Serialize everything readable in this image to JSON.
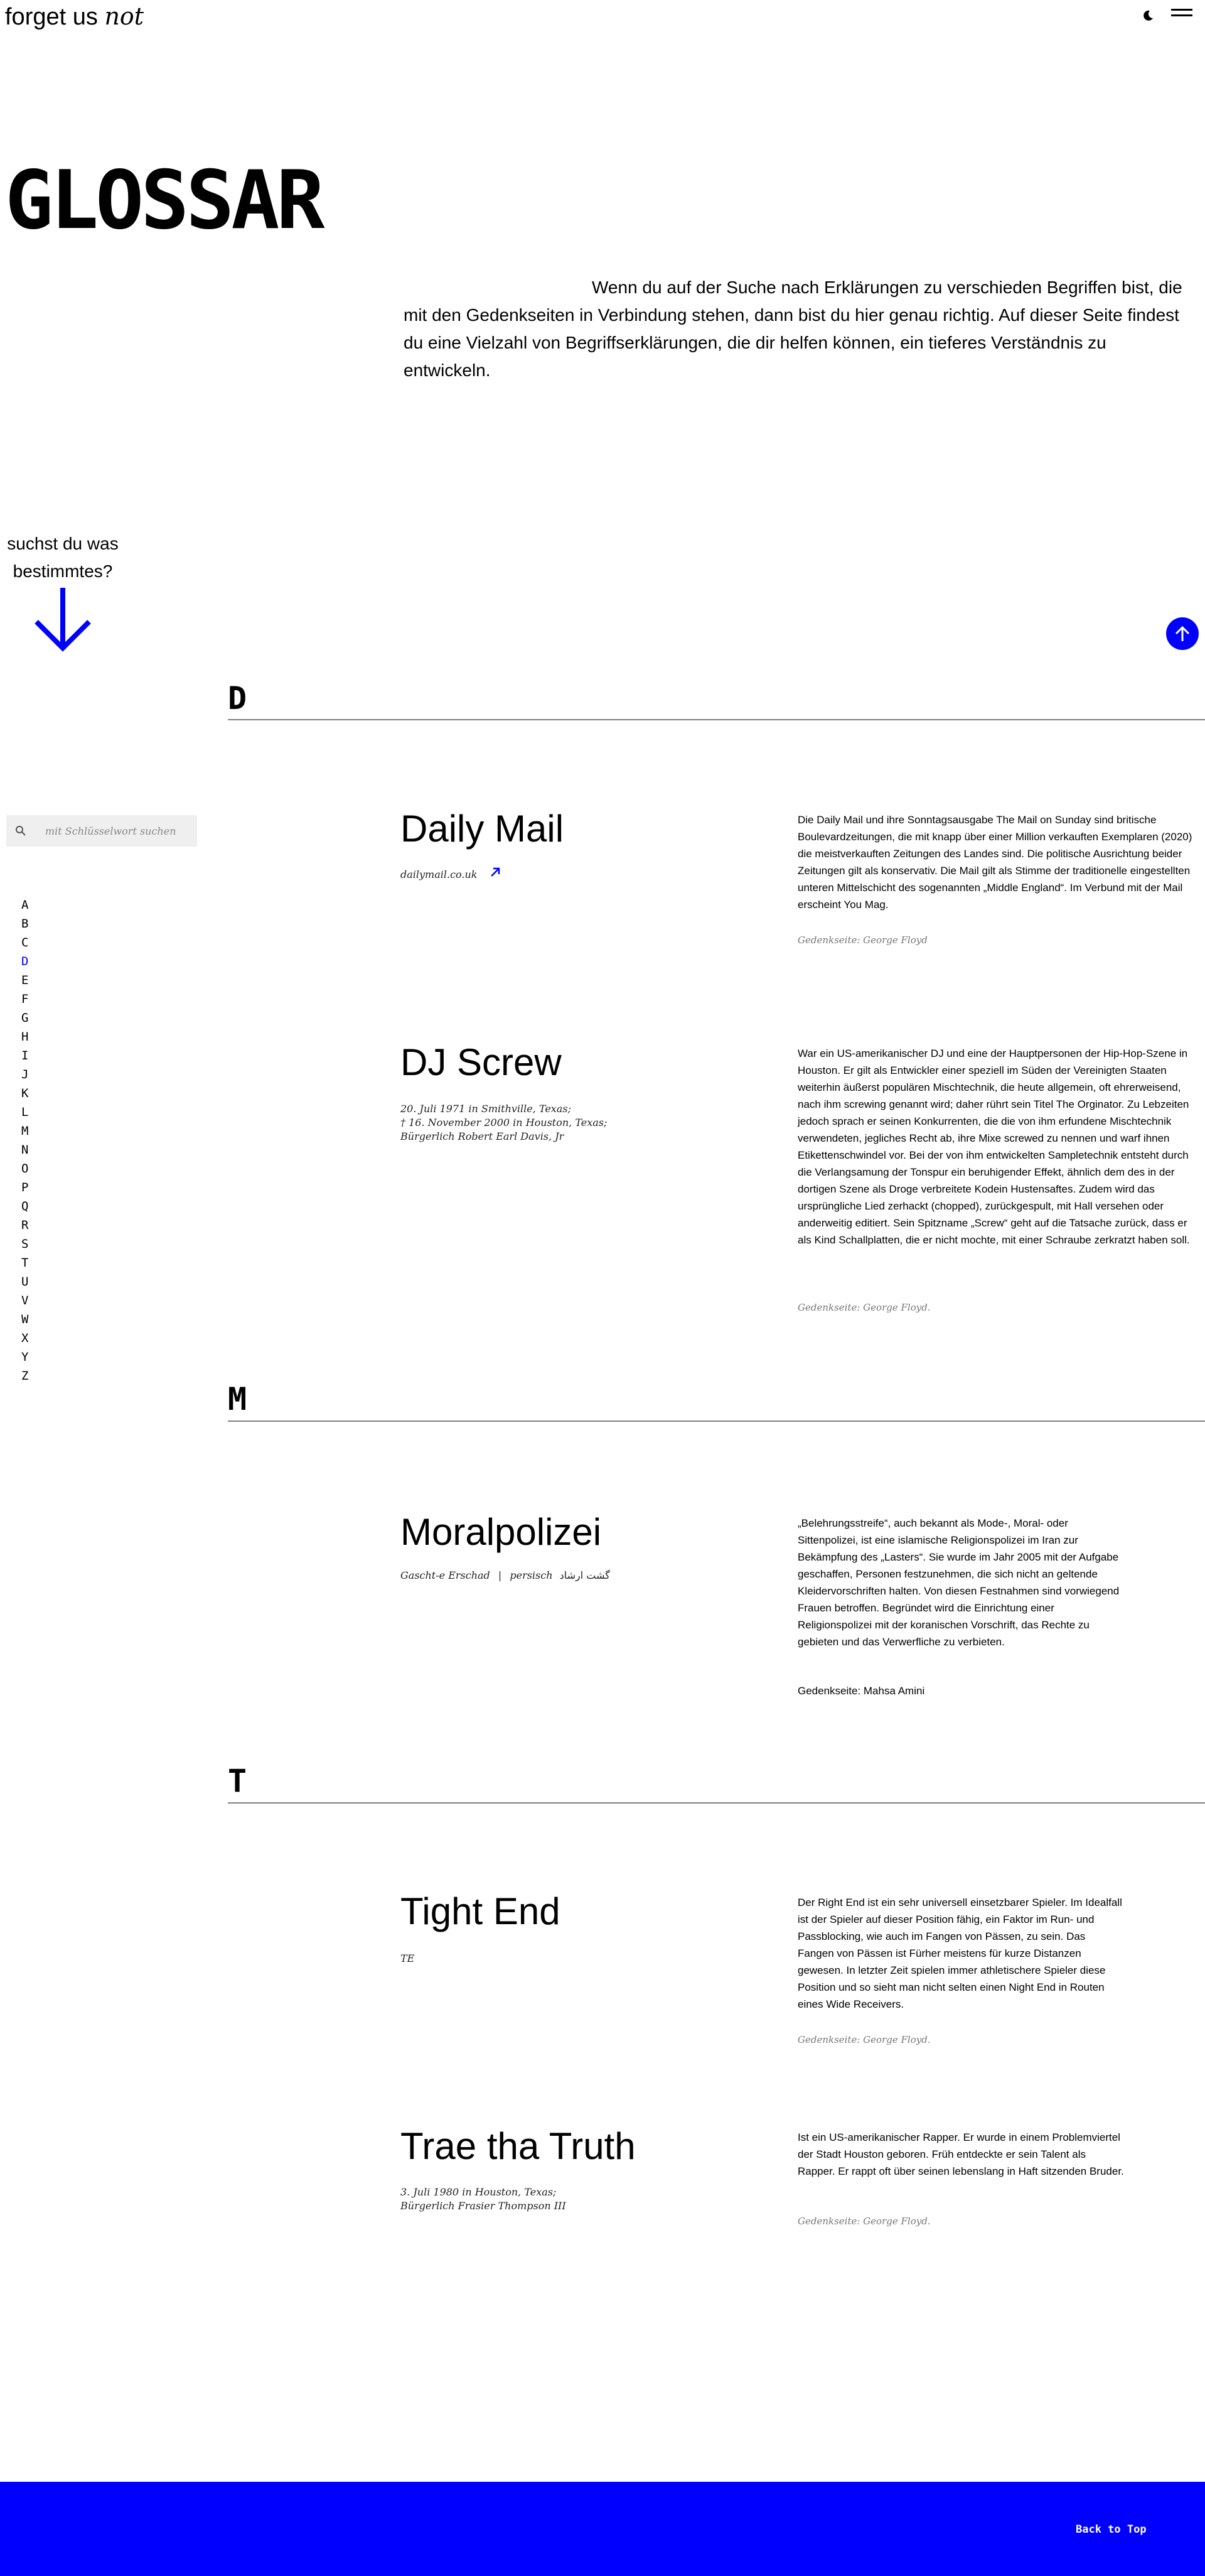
{
  "header": {
    "logo_main": "forget us",
    "logo_italic": "not"
  },
  "hero": {
    "title": "GLOSSAR",
    "intro": "Wenn du auf der Suche nach Erklärungen zu verschieden Begriffen bist, die mit den Gedenkseiten in Verbindung stehen, dann bist du hier genau richtig. Auf dieser Seite findest du eine Vielzahl von Begriffserklärungen, die dir helfen können, ein tieferes Verständnis zu entwickeln."
  },
  "sidebar": {
    "prompt_line1": "suchst du was",
    "prompt_line2": "bestimmtes?",
    "search_placeholder": "mit Schlüsselwort suchen",
    "letters": [
      "A",
      "B",
      "C",
      "D",
      "E",
      "F",
      "G",
      "H",
      "I",
      "J",
      "K",
      "L",
      "M",
      "N",
      "O",
      "P",
      "Q",
      "R",
      "S",
      "T",
      "U",
      "V",
      "W",
      "X",
      "Y",
      "Z"
    ],
    "active_letter": "D"
  },
  "sections": {
    "d": "D",
    "m": "M",
    "t": "T"
  },
  "entries": {
    "daily_mail": {
      "title": "Daily Mail",
      "link": "dailymail.co.uk",
      "desc": "Die Daily Mail und ihre Sonntagsausgabe The Mail on Sunday sind britische Boulevardzeitungen, die mit knapp über einer Million verkauften Exemplaren (2020) die meistverkauften Zeitungen des Landes sind. Die politische Ausrichtung beider Zeitungen gilt als konservativ. Die Mail gilt als Stimme der traditionelle eingestellten unteren Mittelschicht des sogenannten „Middle England“. Im Verbund mit der Mail erscheint You Mag.",
      "ref": "Gedenkseite: George Floyd"
    },
    "dj_screw": {
      "title": "DJ Screw",
      "meta1": "20. Juli 1971 in Smithville, Texas;",
      "meta2": "† 16. November 2000 in Houston, Texas;",
      "meta3": "Bürgerlich Robert Earl Davis, Jr",
      "desc": "War ein US-amerikanischer DJ und eine der Hauptpersonen der Hip-Hop-Szene in Houston. Er gilt als Entwickler einer speziell im Süden der Vereinigten Staaten weiterhin äußerst populären Mischtechnik, die heute allgemein, oft ehrerweisend, nach ihm screwing genannt wird; daher rührt sein Titel The Orginator. Zu Lebzeiten jedoch sprach er seinen Konkurrenten, die die von ihm erfundene Mischtechnik verwendeten, jegliches Recht ab, ihre Mixe screwed zu nennen und warf ihnen Etikettenschwindel vor. Bei der von ihm entwickelten Sampletechnik entsteht durch die Verlangsamung der Tonspur ein beruhigender Effekt, ähnlich dem des in der dortigen Szene als Droge verbreitete Kodein Hustensaftes. Zudem wird das ursprüngliche Lied zerhackt (chopped), zurückgespult, mit Hall versehen oder anderweitig editiert. Sein Spitzname „Screw“ geht auf die Tatsache zurück, dass er als Kind Schallplatten, die er nicht mochte, mit einer Schraube zerkratzt haben soll.",
      "ref": "Gedenkseite: George Floyd."
    },
    "moralpolizei": {
      "title": "Moralpolizei",
      "meta_a": "Gascht-e Erschad",
      "meta_b": "persisch",
      "meta_c": "گشت ارشاد",
      "desc": "„Belehrungsstreife“, auch bekannt als Mode-, Moral- oder Sittenpolizei, ist eine islamische Religionspolizei im Iran zur Bekämpfung des „Lasters“. Sie wurde im Jahr 2005 mit der Aufgabe geschaffen, Personen festzunehmen, die sich nicht an geltende Kleidervorschriften halten. Von diesen Festnahmen sind vorwiegend Frauen betroffen. Begründet wird die Einrichtung einer Religionspolizei mit der koranischen Vorschrift, das Rechte zu gebieten und das Verwerfliche zu verbieten.",
      "ref": "Gedenkseite: Mahsa Amini"
    },
    "tight_end": {
      "title": "Tight End",
      "meta": "TE",
      "desc": "Der Right End ist ein sehr universell einsetzbarer Spieler. Im Idealfall ist der Spieler auf dieser Position fähig, ein Faktor im Run- und Passblocking, wie auch im Fangen von Pässen, zu sein. Das Fangen von Pässen ist Fürher meistens für kurze Distanzen gewesen. In letzter Zeit spielen immer athletischere Spieler diese Position und so sieht man nicht selten einen Night End in Routen eines Wide Receivers.",
      "ref": "Gedenkseite: George Floyd."
    },
    "trae": {
      "title": "Trae tha Truth",
      "meta1": "3. Juli 1980 in Houston, Texas;",
      "meta2": "Bürgerlich Frasier Thompson III",
      "desc": "Ist ein US-amerikanischer Rapper. Er wurde in einem Problemviertel der Stadt Houston geboren. Früh entdeckte er sein Talent als Rapper. Er rappt oft über seinen lebenslang in Haft sitzenden Bruder.",
      "ref": "Gedenkseite: George Floyd."
    }
  },
  "footer": {
    "back_to_top": "Back to Top"
  },
  "colors": {
    "accent": "#0000ff",
    "rule": "#808080",
    "search_bg": "#efefef"
  }
}
